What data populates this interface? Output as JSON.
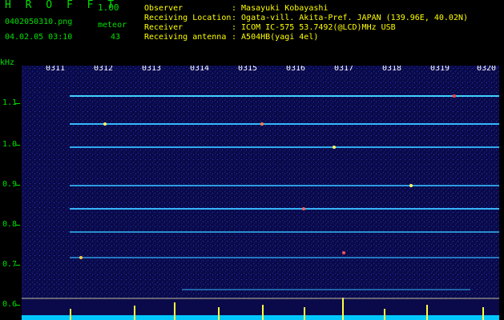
{
  "app": {
    "title": "H R O F F T",
    "version": "1.00"
  },
  "file": {
    "name": "0402050310.png",
    "datetime": "04.02.05 03:10"
  },
  "meteor": {
    "label": "meteor",
    "count": "43"
  },
  "info": [
    {
      "key": "Observer",
      "value": ": Masayuki Kobayashi"
    },
    {
      "key": "Receiving Location",
      "value": ": Ogata-vill. Akita-Pref. JAPAN (139.96E, 40.02N)"
    },
    {
      "key": "Receiver",
      "value": ": ICOM IC-575 53.7492(@LCD)MHz USB"
    },
    {
      "key": "Receiving antenna",
      "value": ": A504HB(yagi 4el)"
    }
  ],
  "axis": {
    "unit": "kHz",
    "freq_labels": [
      "1.1",
      "1.0",
      "0.9",
      "0.8",
      "0.7",
      "0.6"
    ],
    "time_labels": [
      "0311",
      "0312",
      "0313",
      "0314",
      "0315",
      "0316",
      "0317",
      "0318",
      "0319",
      "0320"
    ]
  },
  "colors": {
    "label_green": "#00e000",
    "header_yellow": "#ffff00",
    "background": "#0a0a4a"
  }
}
